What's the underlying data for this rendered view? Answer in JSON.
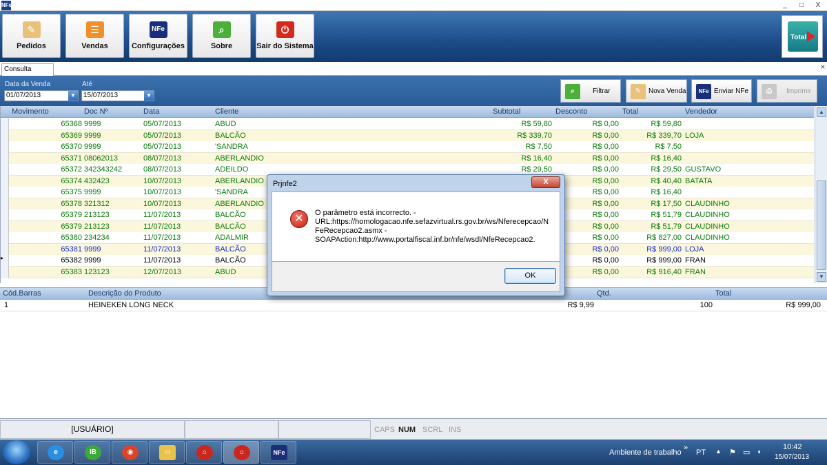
{
  "window": {
    "app_icon": "NFe",
    "controls": [
      "_",
      "□",
      "X"
    ]
  },
  "ribbon": {
    "buttons": [
      {
        "label": "Pedidos",
        "icon": "pencil-note-icon"
      },
      {
        "label": "Vendas",
        "icon": "list-icon"
      },
      {
        "label": "Configurações",
        "icon": "nfe-icon",
        "icon_text": "NFe"
      },
      {
        "label": "Sobre",
        "icon": "magnifier-icon"
      },
      {
        "label": "Sair do Sistema",
        "icon": "power-icon"
      }
    ],
    "logo_text": "Total"
  },
  "tab": {
    "label": "Consulta Vendas",
    "close": "⨯"
  },
  "filters": {
    "from_label": "Data da Venda",
    "from_value": "01/07/2013",
    "to_label": "Até",
    "to_value": "15/07/2013",
    "buttons": {
      "filtrar": "Filtrar",
      "nova_venda": "Nova Venda",
      "enviar_nfe": "Enviar NFe",
      "imprimir": "Imprimir"
    }
  },
  "sales_grid": {
    "headers": {
      "movimento": "Movimento",
      "doc": "Doc Nº",
      "data": "Data",
      "cliente": "Cliente",
      "subtotal": "Subtotal",
      "desconto": "Desconto",
      "total": "Total",
      "vendedor": "Vendedor"
    },
    "rows": [
      {
        "movimento": "65368",
        "doc": "9999",
        "data": "05/07/2013",
        "cliente": "ABUD",
        "subtotal": "R$ 59,80",
        "desconto": "R$ 0,00",
        "total": "R$ 59,80",
        "vendedor": ""
      },
      {
        "movimento": "65369",
        "doc": "9999",
        "data": "05/07/2013",
        "cliente": "BALCÃO",
        "subtotal": "R$ 339,70",
        "desconto": "R$ 0,00",
        "total": "R$ 339,70",
        "vendedor": "LOJA"
      },
      {
        "movimento": "65370",
        "doc": "9999",
        "data": "05/07/2013",
        "cliente": "'SANDRA",
        "subtotal": "R$ 7,50",
        "desconto": "R$ 0,00",
        "total": "R$ 7,50",
        "vendedor": ""
      },
      {
        "movimento": "65371",
        "doc": "08062013",
        "data": "08/07/2013",
        "cliente": "ABERLANDIO",
        "subtotal": "R$ 16,40",
        "desconto": "R$ 0,00",
        "total": "R$ 16,40",
        "vendedor": ""
      },
      {
        "movimento": "65372",
        "doc": "342343242",
        "data": "08/07/2013",
        "cliente": "ADEILDO",
        "subtotal": "R$ 29,50",
        "desconto": "R$ 0,00",
        "total": "R$ 29,50",
        "vendedor": "GUSTAVO"
      },
      {
        "movimento": "65374",
        "doc": "432423",
        "data": "10/07/2013",
        "cliente": "ABERLANDIO",
        "subtotal": "",
        "desconto": "R$ 0,00",
        "total": "R$ 40,40",
        "vendedor": "BATATA"
      },
      {
        "movimento": "65375",
        "doc": "9999",
        "data": "10/07/2013",
        "cliente": "'SANDRA",
        "subtotal": "",
        "desconto": "R$ 0,00",
        "total": "R$ 16,40",
        "vendedor": ""
      },
      {
        "movimento": "65378",
        "doc": "321312",
        "data": "10/07/2013",
        "cliente": "ABERLANDIO",
        "subtotal": "",
        "desconto": "R$ 0,00",
        "total": "R$ 17,50",
        "vendedor": "CLAUDINHO"
      },
      {
        "movimento": "65379",
        "doc": "213123",
        "data": "11/07/2013",
        "cliente": "BALCÃO",
        "subtotal": "",
        "desconto": "R$ 0,00",
        "total": "R$ 51,79",
        "vendedor": "CLAUDINHO"
      },
      {
        "movimento": "65379",
        "doc": "213123",
        "data": "11/07/2013",
        "cliente": "BALCÃO",
        "subtotal": "",
        "desconto": "R$ 0,00",
        "total": "R$ 51,79",
        "vendedor": "CLAUDINHO"
      },
      {
        "movimento": "65380",
        "doc": "234234",
        "data": "11/07/2013",
        "cliente": "ADALMIR",
        "subtotal": "",
        "desconto": "R$ 0,00",
        "total": "R$ 827,00",
        "vendedor": "CLAUDINHO"
      },
      {
        "movimento": "65381",
        "doc": "9999",
        "data": "11/07/2013",
        "cliente": "BALCÃO",
        "subtotal": "",
        "desconto": "R$ 0,00",
        "total": "R$ 999,00",
        "vendedor": "LOJA"
      },
      {
        "movimento": "65382",
        "doc": "9999",
        "data": "11/07/2013",
        "cliente": "BALCÃO",
        "subtotal": "",
        "desconto": "R$ 0,00",
        "total": "R$ 999,00",
        "vendedor": "FRAN"
      },
      {
        "movimento": "65383",
        "doc": "123123",
        "data": "12/07/2013",
        "cliente": "ABUD",
        "subtotal": "",
        "desconto": "R$ 0,00",
        "total": "R$ 916,40",
        "vendedor": "FRAN"
      }
    ],
    "row_colors": {
      "green": "#0a7a0a",
      "blue": "#1a2ad0",
      "black": "#000000"
    }
  },
  "detail_grid": {
    "headers": {
      "cod": "Cód.Barras",
      "descricao": "Descrição do Produto",
      "qtd": "Qtd.",
      "total": "Total"
    },
    "row": {
      "cod": "1",
      "descricao": "HEINEKEN LONG NECK",
      "preco": "R$ 9,99",
      "qtd": "100",
      "total": "R$ 999,00"
    }
  },
  "statusbar": {
    "user": "[USUÁRIO]",
    "keys": [
      "CAPS",
      "NUM",
      "SCRL",
      "INS"
    ]
  },
  "taskbar": {
    "desktop_label": "Ambiente de trabalho",
    "lang": "PT",
    "time": "10:42",
    "date": "15/07/2013",
    "overflow": "»"
  },
  "dialog": {
    "title": "Prjnfe2",
    "close": "X",
    "message": "O parâmetro está incorrecto. -\nURL:https://homologacao.nfe.sefazvirtual.rs.gov.br/ws/Nferecepcao/N\nFeRecepcao2.asmx -\nSOAPAction:http://www.portalfiscal.inf.br/nfe/wsdl/NfeRecepcao2.",
    "ok_label": "OK"
  }
}
